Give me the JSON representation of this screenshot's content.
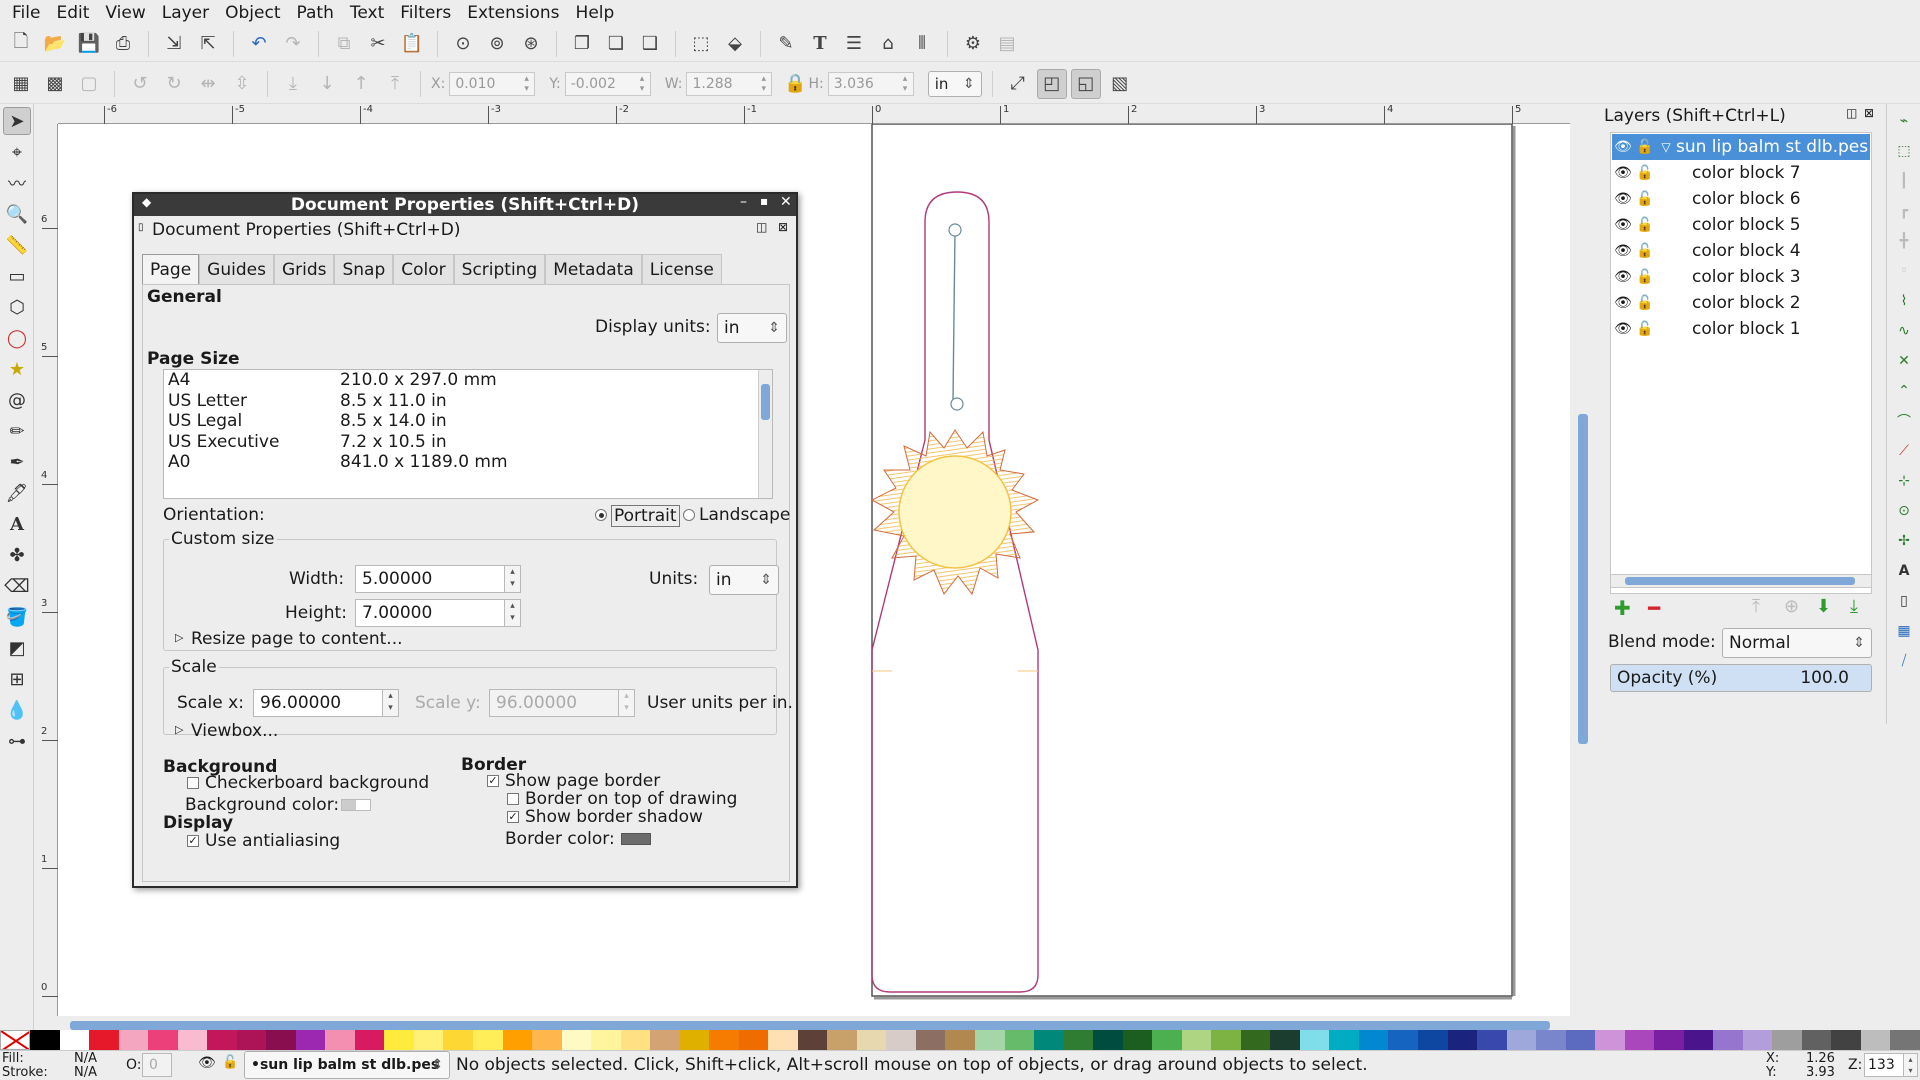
{
  "menubar": [
    "File",
    "Edit",
    "View",
    "Layer",
    "Object",
    "Path",
    "Text",
    "Filters",
    "Extensions",
    "Help"
  ],
  "toolbar2": {
    "x_label": "X:",
    "x_value": "0.010",
    "y_label": "Y:",
    "y_value": "-0.002",
    "w_label": "W:",
    "w_value": "1.288",
    "h_label": "H:",
    "h_value": "3.036",
    "unit": "in"
  },
  "ruler_h": [
    "-6",
    "-5",
    "-4",
    "-3",
    "-2",
    "-1",
    "0",
    "1",
    "2",
    "3",
    "4",
    "5"
  ],
  "ruler_v": [
    "6",
    "5",
    "4",
    "3",
    "2",
    "1",
    "0"
  ],
  "dialog": {
    "window_title": "Document Properties (Shift+Ctrl+D)",
    "panel_title": "Document Properties (Shift+Ctrl+D)",
    "tabs": [
      "Page",
      "Guides",
      "Grids",
      "Snap",
      "Color",
      "Scripting",
      "Metadata",
      "License"
    ],
    "general": "General",
    "display_units_label": "Display units:",
    "display_units_value": "in",
    "page_size": "Page Size",
    "sizes": [
      {
        "name": "A4",
        "dim": "210.0 x 297.0 mm"
      },
      {
        "name": "US Letter",
        "dim": "8.5 x 11.0 in"
      },
      {
        "name": "US Legal",
        "dim": "8.5 x 14.0 in"
      },
      {
        "name": "US Executive",
        "dim": "7.2 x 10.5 in"
      },
      {
        "name": "A0",
        "dim": "841.0 x 1189.0 mm"
      }
    ],
    "orientation_label": "Orientation:",
    "portrait": "Portrait",
    "landscape": "Landscape",
    "custom_size": "Custom size",
    "width_label": "Width:",
    "width_value": "5.00000",
    "height_label": "Height:",
    "height_value": "7.00000",
    "units_label": "Units:",
    "units_value": "in",
    "resize_label": "Resize page to content...",
    "scale": "Scale",
    "scale_x_label": "Scale x:",
    "scale_x_value": "96.00000",
    "scale_y_label": "Scale y:",
    "scale_y_value": "96.00000",
    "user_units": "User units per in.",
    "viewbox": "Viewbox...",
    "background": "Background",
    "checkerboard": "Checkerboard background",
    "bg_color": "Background color:",
    "display": "Display",
    "antialias": "Use antialiasing",
    "border": "Border",
    "show_border": "Show page border",
    "border_top": "Border on top of drawing",
    "border_shadow": "Show border shadow",
    "border_color": "Border color:"
  },
  "layers": {
    "title": "Layers (Shift+Ctrl+L)",
    "root": "sun lip balm st dlb.pes",
    "items": [
      "color block 7",
      "color block 6",
      "color block 5",
      "color block 4",
      "color block 3",
      "color block 2",
      "color block 1"
    ],
    "blend_label": "Blend mode:",
    "blend_value": "Normal",
    "opacity_label": "Opacity (%)",
    "opacity_value": "100.0"
  },
  "palette": [
    "#000000",
    "#ffffff",
    "#e6192b",
    "#f4a6c1",
    "#ec407a",
    "#f8bbd0",
    "#c2185b",
    "#ad1457",
    "#880e4f",
    "#9c27b0",
    "#f48fb1",
    "#d81b60",
    "#ffeb3b",
    "#fff176",
    "#fdd835",
    "#ffee58",
    "#ffa000",
    "#ffb74d",
    "#fff9c4",
    "#fff59d",
    "#ffe082",
    "#d4a373",
    "#e0b000",
    "#f57c00",
    "#ef6c00",
    "#ffe0b2",
    "#5d4037",
    "#c8a06a",
    "#e8d8b0",
    "#d7ccc8",
    "#8d6e63",
    "#b08850",
    "#a5d6a7",
    "#66bb6a",
    "#00897b",
    "#2e7d32",
    "#004d40",
    "#1b5e20",
    "#4caf50",
    "#aed581",
    "#7cb342",
    "#33691e",
    "#1b3d2f",
    "#80deea",
    "#00acc1",
    "#0288d1",
    "#1565c0",
    "#0d47a1",
    "#1a237e",
    "#3949ab",
    "#9fa8da",
    "#7986cb",
    "#5c6bc0",
    "#ce93d8",
    "#ab47bc",
    "#7b1fa2",
    "#4a148c",
    "#9575cd",
    "#b39ddb",
    "#9e9e9e",
    "#616161",
    "#424242",
    "#bdbdbd",
    "#757575"
  ],
  "status": {
    "fill_label": "Fill:",
    "fill_value": "N/A",
    "stroke_label": "Stroke:",
    "stroke_value": "N/A",
    "opacity_label": "O:",
    "opacity_value": "0",
    "layer": "•sun lip balm st dlb.pes",
    "message": "No objects selected. Click, Shift+click, Alt+scroll mouse on top of objects, or drag around objects to select.",
    "x_label": "X:",
    "x_value": "1.26",
    "y_label": "Y:",
    "y_value": "3.93",
    "zoom_label": "Z:",
    "zoom_value": "133"
  }
}
